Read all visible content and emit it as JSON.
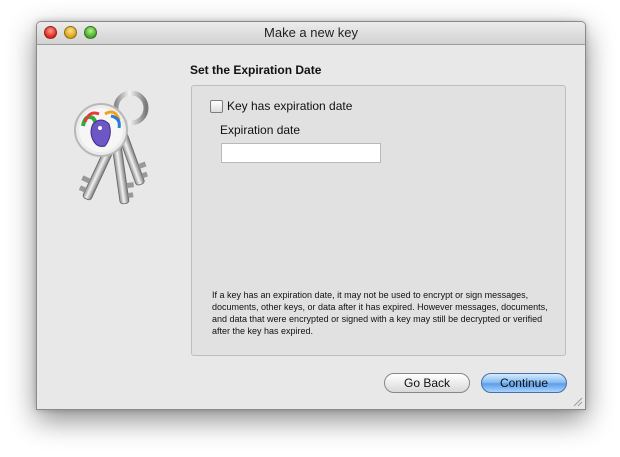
{
  "window": {
    "title": "Make a new key"
  },
  "section": {
    "title": "Set the Expiration Date"
  },
  "expiration": {
    "checkbox_label": "Key has expiration date",
    "checked": false,
    "date_label": "Expiration date",
    "date_value": ""
  },
  "help_text": "If a key has an expiration date, it may not be used to encrypt or sign messages, documents, other keys, or data after it has expired. However messages, documents, and data that were encrypted or signed with a key may still be decrypted or verified after the key has expired.",
  "buttons": {
    "back_label": "Go Back",
    "continue_label": "Continue"
  },
  "icons": {
    "app_icon": "keys-icon",
    "logo": "gnupg-logo-icon"
  },
  "colors": {
    "accent": "#5d9ee8",
    "window_bg": "#e8e8e8"
  }
}
